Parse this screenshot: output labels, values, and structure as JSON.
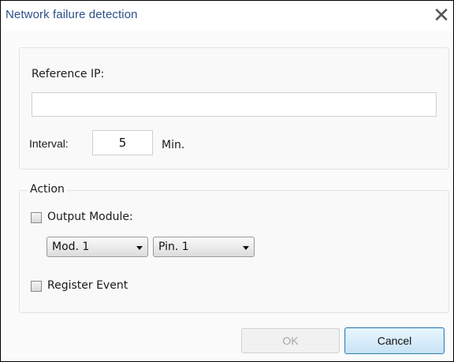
{
  "dialog": {
    "title": "Network failure detection",
    "close_glyph": "✕"
  },
  "settings": {
    "reference_ip_label": "Reference IP:",
    "reference_ip_value": "",
    "interval_label": "Interval:",
    "interval_value": "5",
    "interval_unit": "Min."
  },
  "action": {
    "group_label": "Action",
    "output_module_label": "Output Module:",
    "output_module_checked": false,
    "module_select_value": "Mod. 1",
    "pin_select_value": "Pin. 1",
    "register_event_label": "Register Event",
    "register_event_checked": false
  },
  "buttons": {
    "ok_label": "OK",
    "ok_enabled": false,
    "cancel_label": "Cancel"
  },
  "colors": {
    "title_text": "#2d4f88",
    "cancel_border": "#3c7fb1",
    "disabled_text": "#a7a7a7"
  }
}
